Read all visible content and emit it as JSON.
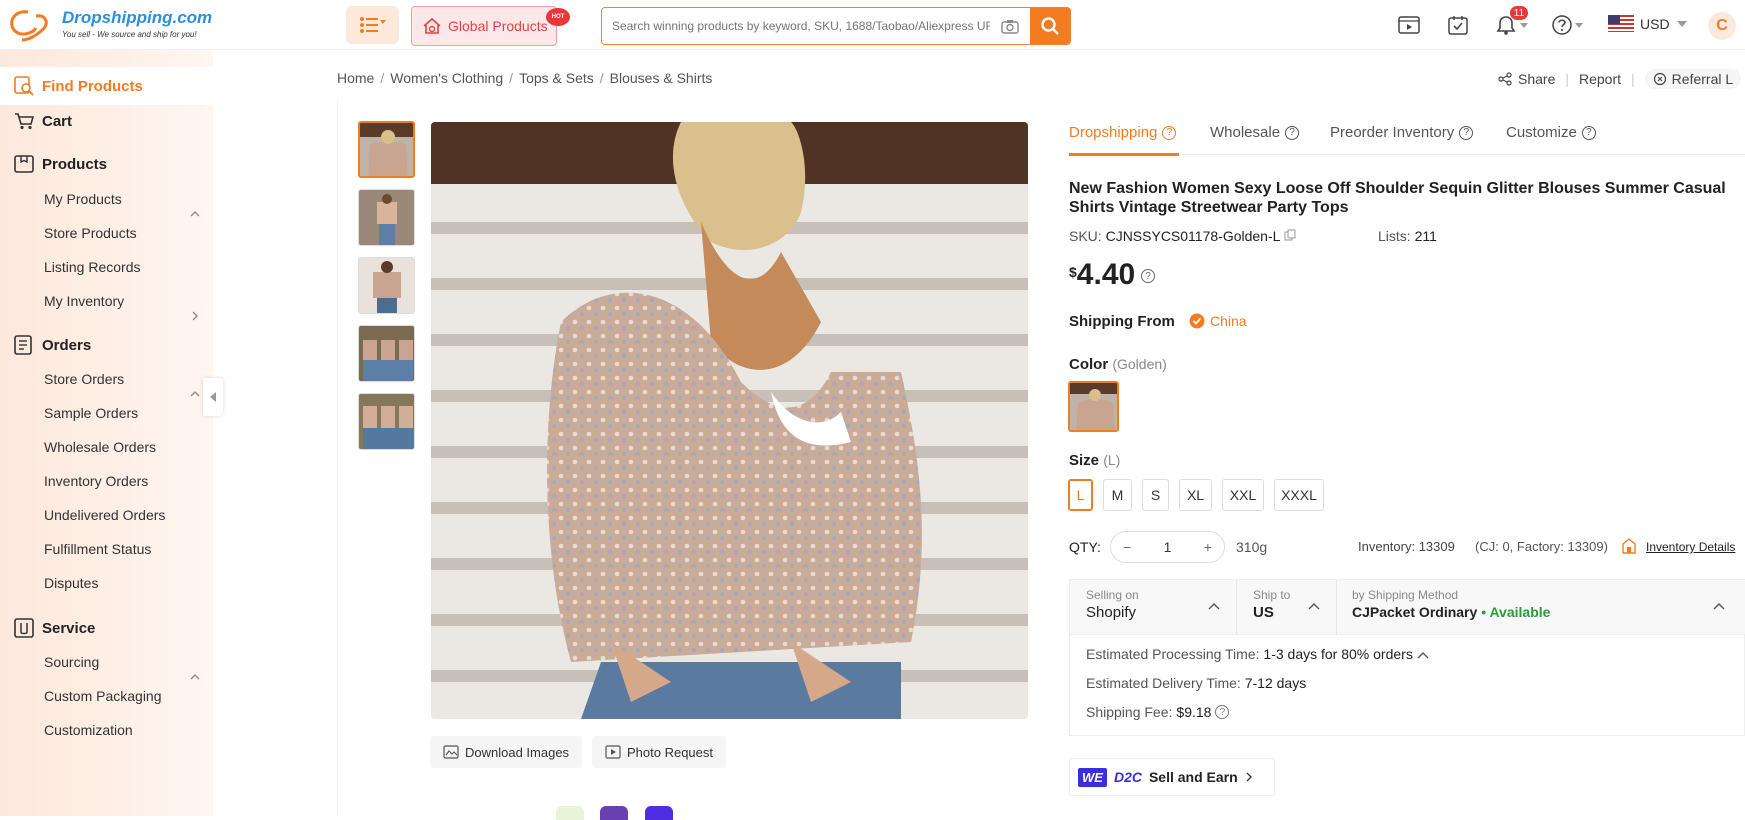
{
  "header": {
    "logo_text": "Dropshipping.com",
    "logo_sub": "You sell - We source and ship for you!",
    "global_products": "Global Products",
    "hot_badge": "HOT",
    "search_placeholder": "Search winning products by keyword, SKU, 1688/Taobao/Aliexpress URL",
    "notification_count": "11",
    "currency": "USD",
    "avatar_letter": "C"
  },
  "sidebar": {
    "find_products": "Find Products",
    "cart": "Cart",
    "products": {
      "label": "Products",
      "items": [
        "My Products",
        "Store Products",
        "Listing Records",
        "My Inventory"
      ]
    },
    "orders": {
      "label": "Orders",
      "items": [
        "Store Orders",
        "Sample Orders",
        "Wholesale Orders",
        "Inventory Orders",
        "Undelivered Orders",
        "Fulfillment Status",
        "Disputes"
      ]
    },
    "service": {
      "label": "Service",
      "items": [
        "Sourcing",
        "Custom Packaging",
        "Customization"
      ]
    }
  },
  "breadcrumb": [
    "Home",
    "Women's Clothing",
    "Tops & Sets",
    "Blouses & Shirts"
  ],
  "breadcrumb_sep": "/",
  "tools": {
    "share": "Share",
    "report": "Report",
    "referral": "Referral L"
  },
  "gallery": {
    "download": "Download Images",
    "photo_request": "Photo Request"
  },
  "tabs": [
    "Dropshipping",
    "Wholesale",
    "Preorder Inventory",
    "Customize"
  ],
  "product": {
    "title": "New Fashion Women Sexy Loose Off Shoulder Sequin Glitter Blouses Summer Casual Shirts Vintage Streetwear Party Tops",
    "sku_label": "SKU:",
    "sku": "CJNSSYCS01178-Golden-L",
    "lists_label": "Lists:",
    "lists": "211",
    "currency_symbol": "$",
    "price": "4.40",
    "shipping_from_label": "Shipping From",
    "shipping_from": "China",
    "color_label": "Color",
    "color_value": "(Golden)",
    "size_label": "Size",
    "size_value": "(L)",
    "sizes": [
      "L",
      "M",
      "S",
      "XL",
      "XXL",
      "XXXL"
    ],
    "qty_label": "QTY:",
    "qty": "1",
    "weight": "310g",
    "inventory": "Inventory: 13309",
    "inventory_detail": "(CJ: 0, Factory: 13309)",
    "inventory_link": "Inventory Details"
  },
  "shipping": {
    "selling_on_label": "Selling on",
    "selling_on": "Shopify",
    "ship_to_label": "Ship to",
    "ship_to": "US",
    "method_label": "by Shipping Method",
    "method": "CJPacket Ordinary",
    "available": "• Available",
    "processing_label": "Estimated Processing Time:",
    "processing": "1-3 days for 80% orders",
    "delivery_label": "Estimated Delivery Time:",
    "delivery": "7-12 days",
    "fee_label": "Shipping Fee:",
    "fee": "$9.18"
  },
  "d2c": {
    "we": "WE",
    "d2c": "D2C",
    "label": "Sell and Earn"
  },
  "colors": {
    "accent": "#f37c21",
    "available": "#2e9b3a",
    "we": "#3a2fe0"
  }
}
